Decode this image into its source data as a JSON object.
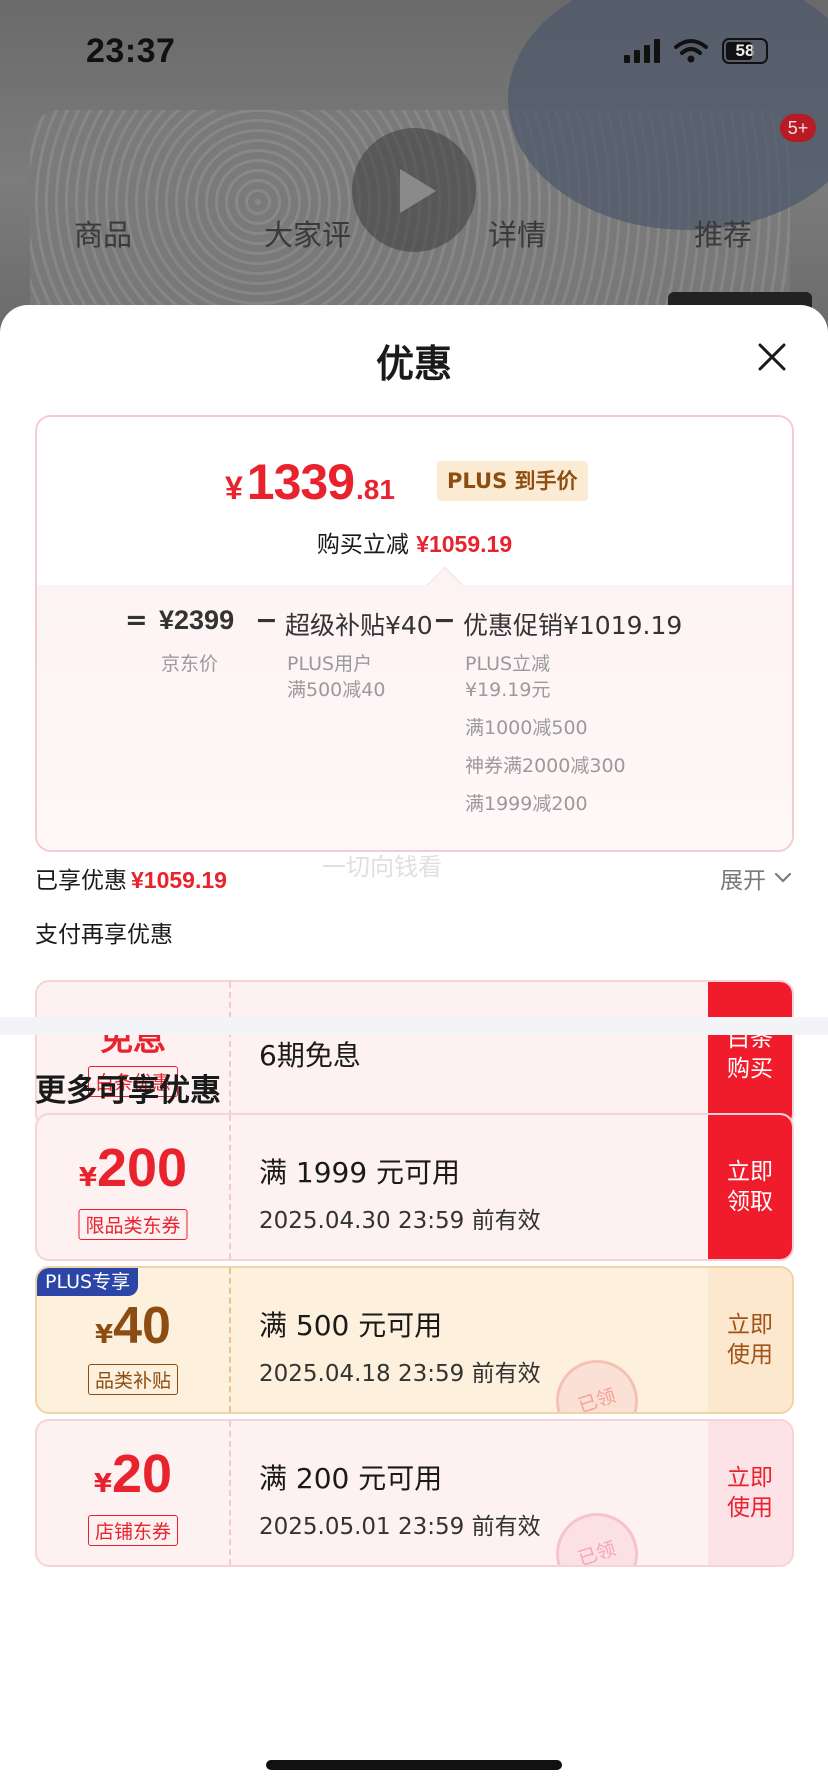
{
  "status_bar": {
    "time": "23:37",
    "battery": "58"
  },
  "background": {
    "badge": "5+",
    "tabs": [
      "商品",
      "大家评",
      "详情",
      "推荐"
    ]
  },
  "sheet": {
    "title": "优惠",
    "price": {
      "currency": "¥",
      "integer": "1339",
      "decimal": ".81",
      "tag": "PLUS 到手价"
    },
    "instant": {
      "label": "购买立减",
      "amount": "¥1059.19"
    },
    "formula": {
      "equals": "=",
      "minus": "−",
      "jd_price": {
        "value": "¥2399",
        "label": "京东价"
      },
      "super_subsidy": {
        "value": "超级补贴¥40",
        "lines": [
          "PLUS用户",
          "满500减40"
        ]
      },
      "promo": {
        "value": "优惠促销¥1019.19",
        "lines": [
          "PLUS立减",
          "¥19.19元",
          "满1000减500",
          "神券满2000减300",
          "满1999减200"
        ]
      }
    },
    "watermark": "一切向钱看",
    "enjoyed": {
      "label": "已享优惠",
      "amount": "¥1059.19"
    },
    "expand_label": "展开",
    "pay_more_label": "支付再享优惠",
    "baitiao": {
      "title": "免息",
      "tag": "白条优惠",
      "desc": "6期免息",
      "action": "白条\n购买"
    },
    "more_title": "更多可享优惠",
    "coupons": [
      {
        "currency": "¥",
        "amount": "200",
        "tag": "限品类东券",
        "condition": "满 1999 元可用",
        "expire": "2025.04.30 23:59 前有效",
        "action": "立即\n领取"
      },
      {
        "corner": "PLUS专享",
        "currency": "¥",
        "amount": "40",
        "tag": "品类补贴",
        "condition": "满 500 元可用",
        "expire": "2025.04.18 23:59 前有效",
        "action": "立即\n使用",
        "stamp": "已领"
      },
      {
        "currency": "¥",
        "amount": "20",
        "tag": "店铺东券",
        "condition": "满 200 元可用",
        "expire": "2025.05.01 23:59 前有效",
        "action": "立即\n使用",
        "stamp": "已领"
      }
    ]
  },
  "colors": {
    "accent_red": "#e8232d",
    "gold": "#8d4d12",
    "plus_blue": "#2c46a8"
  }
}
